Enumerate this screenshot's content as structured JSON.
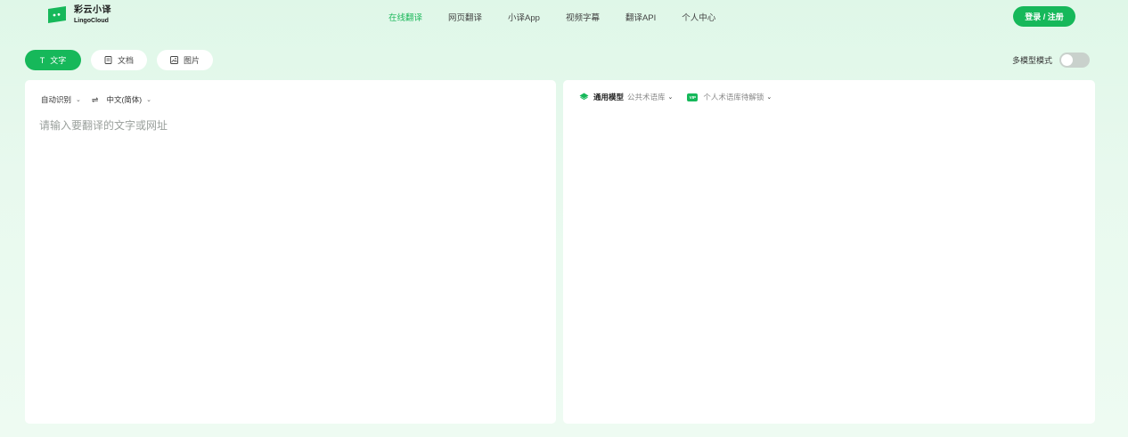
{
  "app": {
    "name_cn": "彩云小译",
    "name_en": "LingoCloud"
  },
  "nav": {
    "items": [
      {
        "label": "在线翻译",
        "active": true
      },
      {
        "label": "网页翻译",
        "active": false
      },
      {
        "label": "小译App",
        "active": false
      },
      {
        "label": "视频字幕",
        "active": false
      },
      {
        "label": "翻译API",
        "active": false
      },
      {
        "label": "个人中心",
        "active": false
      }
    ]
  },
  "header": {
    "login_label": "登录 / 注册"
  },
  "tabs": [
    {
      "label": "文字",
      "icon": "text-icon",
      "active": true
    },
    {
      "label": "文档",
      "icon": "document-icon",
      "active": false
    },
    {
      "label": "图片",
      "icon": "image-icon",
      "active": false
    }
  ],
  "multi_model": {
    "label": "多模型模式",
    "enabled": false
  },
  "source": {
    "language": "自动识别",
    "target_language": "中文(简体)",
    "placeholder": "请输入要翻译的文字或网址",
    "value": ""
  },
  "result": {
    "model_name": "通用模型",
    "model_sub": "公共术语库",
    "term_label": "个人术语库待解锁",
    "vip_badge": "VIP"
  },
  "colors": {
    "accent": "#16b85a",
    "active_nav": "#1fb85c",
    "background": "#e3f8ea"
  }
}
